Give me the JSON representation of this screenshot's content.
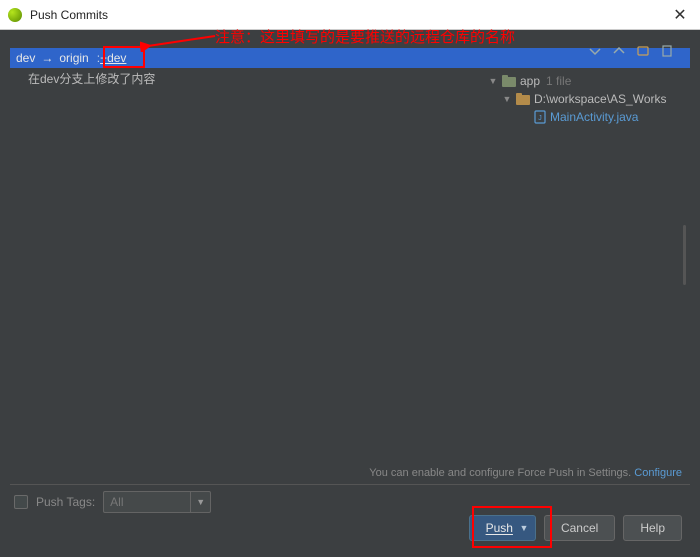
{
  "title": "Push Commits",
  "annotation": "注意：这里填写的是要推送的远程仓库的名称",
  "branch": {
    "local": "dev",
    "arrow": "→",
    "remote": "origin",
    "target": "+dev"
  },
  "commit_message": "在dev分支上修改了内容",
  "toolbar": {
    "icons": [
      "expand-all-icon",
      "collapse-all-icon",
      "group-by-icon",
      "show-diff-icon"
    ]
  },
  "tree": {
    "root": {
      "label": "app",
      "count": "1 file"
    },
    "folder": {
      "label": "D:\\workspace\\AS_Works"
    },
    "file": {
      "label": "MainActivity.java"
    }
  },
  "hint": {
    "text": "You can enable and configure Force Push in Settings.",
    "link": "Configure"
  },
  "push_tags": {
    "label": "Push Tags:",
    "select_value": "All"
  },
  "buttons": {
    "push": "Push",
    "cancel": "Cancel",
    "help": "Help"
  }
}
